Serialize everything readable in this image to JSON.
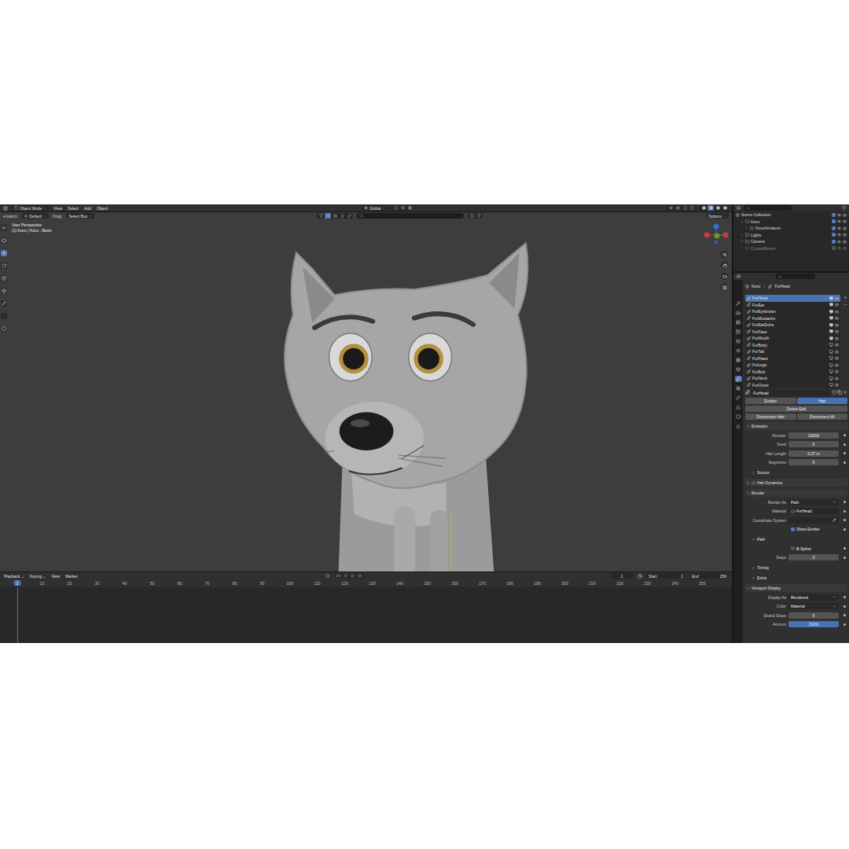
{
  "header": {
    "mode": "Object Mode",
    "menus": [
      "View",
      "Select",
      "Add",
      "Object"
    ],
    "transform_space": "Global",
    "shading": [
      {
        "selected": false
      },
      {
        "selected": true
      },
      {
        "selected": false
      },
      {
        "selected": false
      }
    ]
  },
  "tool_settings": {
    "orientation_label": "entation:",
    "orientation": "Default",
    "drag_label": "Drag:",
    "drag": "Select Box",
    "options": "Options"
  },
  "viewport": {
    "perspective": "User Perspective",
    "object_info": "(1) Kovu | Kovu : Basis"
  },
  "tools": [
    {
      "selected": false
    },
    {
      "selected": false
    },
    {
      "selected": true
    },
    {
      "selected": false
    },
    {
      "selected": false
    },
    {
      "selected": false
    },
    {
      "selected": false
    },
    {
      "selected": false
    },
    {
      "selected": false
    }
  ],
  "timeline": {
    "menus": [
      "Playback",
      "Keying",
      "View",
      "Marker"
    ],
    "current_frame": "1",
    "start_label": "Start",
    "start": "1",
    "end_label": "End",
    "end": "250",
    "ruler": [
      "1",
      "10",
      "20",
      "30",
      "40",
      "50",
      "60",
      "70",
      "80",
      "90",
      "100",
      "110",
      "120",
      "130",
      "140",
      "150",
      "160",
      "170",
      "180",
      "190",
      "200",
      "210",
      "220",
      "230",
      "240",
      "250"
    ]
  },
  "outliner": {
    "items": [
      {
        "label": "Scene Collection",
        "depth": 0,
        "expanded": true,
        "included": true
      },
      {
        "label": "Kovu",
        "depth": 1,
        "expanded": true,
        "included": true
      },
      {
        "label": "KovuArmature",
        "depth": 2,
        "expanded": false,
        "included": true
      },
      {
        "label": "Lights",
        "depth": 1,
        "expanded": false,
        "included": true
      },
      {
        "label": "Camera",
        "depth": 1,
        "expanded": false,
        "included": true
      },
      {
        "label": "CustomBones",
        "depth": 1,
        "expanded": false,
        "included": false
      }
    ]
  },
  "properties": {
    "tabs": [
      {
        "selected": false
      },
      {
        "selected": false
      },
      {
        "selected": false
      },
      {
        "selected": false
      },
      {
        "selected": false
      },
      {
        "selected": false
      },
      {
        "selected": false
      },
      {
        "selected": false
      },
      {
        "selected": true
      },
      {
        "selected": false
      },
      {
        "selected": false
      },
      {
        "selected": false
      },
      {
        "selected": false
      },
      {
        "selected": false
      }
    ],
    "breadcrumb": [
      "Kovu",
      "FurHead"
    ],
    "particle_systems": [
      {
        "label": "FurHead",
        "selected": true,
        "show_viewport": true
      },
      {
        "label": "FurEar",
        "selected": false,
        "show_viewport": true
      },
      {
        "label": "FurEyebrown",
        "selected": false,
        "show_viewport": true
      },
      {
        "label": "FurMustache",
        "selected": false,
        "show_viewport": true
      },
      {
        "label": "FurEarExtra",
        "selected": false,
        "show_viewport": true
      },
      {
        "label": "FurFace",
        "selected": false,
        "show_viewport": true
      },
      {
        "label": "FurMouth",
        "selected": false,
        "show_viewport": true
      },
      {
        "label": "FurBody",
        "selected": false,
        "show_viewport": false
      },
      {
        "label": "FurTail",
        "selected": false,
        "show_viewport": false
      },
      {
        "label": "FurPaws",
        "selected": false,
        "show_viewport": false
      },
      {
        "label": "FurLegs",
        "selected": false,
        "show_viewport": false
      },
      {
        "label": "FurButt",
        "selected": false,
        "show_viewport": false
      },
      {
        "label": "FurNeck",
        "selected": false,
        "show_viewport": false
      },
      {
        "label": "FurChest",
        "selected": false,
        "show_viewport": false
      }
    ],
    "system_name": "FurHead",
    "type_toggle": [
      {
        "label": "Emitter",
        "selected": false
      },
      {
        "label": "Hair",
        "selected": true
      }
    ],
    "actions": [
      [
        "Delete Edit"
      ],
      [
        "Disconnect Hair",
        "Disconnect All"
      ]
    ],
    "sections": [
      {
        "title": "Emission",
        "kind": "panel",
        "expanded": true,
        "rows": [
          {
            "kind": "number",
            "label": "Number",
            "value": "10000"
          },
          {
            "kind": "number",
            "label": "Seed",
            "value": "0"
          },
          {
            "kind": "number",
            "label": "Hair Length",
            "value": "0.07 m"
          },
          {
            "kind": "number",
            "label": "Segments",
            "value": "5"
          }
        ]
      },
      {
        "title": "Source",
        "kind": "subpanel",
        "expanded": false,
        "rows": []
      },
      {
        "title": "Hair Dynamics",
        "kind": "panel",
        "expanded": false,
        "checkbox": false,
        "rows": []
      },
      {
        "title": "Render",
        "kind": "panel",
        "expanded": true,
        "rows": [
          {
            "kind": "dropdown",
            "label": "Render As",
            "value": "Path"
          },
          {
            "kind": "datablock",
            "label": "Material",
            "value": "FurHead"
          },
          {
            "kind": "picker",
            "label": "Coordinate System"
          },
          {
            "kind": "checkbox",
            "label": "Show Emitter",
            "checked": true
          }
        ]
      },
      {
        "title": "Path",
        "kind": "subpanel",
        "expanded": true,
        "rows": [
          {
            "kind": "checkbox",
            "label": "B-Spline",
            "checked": false
          },
          {
            "kind": "number",
            "label": "Steps",
            "value": "3"
          }
        ]
      },
      {
        "title": "Timing",
        "kind": "subpanel",
        "expanded": false,
        "rows": []
      },
      {
        "title": "Extra",
        "kind": "subpanel",
        "expanded": false,
        "rows": []
      },
      {
        "title": "Viewport Display",
        "kind": "panel",
        "expanded": true,
        "rows": [
          {
            "kind": "dropdown",
            "label": "Display As",
            "value": "Rendered"
          },
          {
            "kind": "dropdown",
            "label": "Color",
            "value": "Material"
          },
          {
            "kind": "number",
            "label": "Strand Steps",
            "value": "5"
          },
          {
            "kind": "slider",
            "label": "Amount",
            "value": "100%",
            "level": 1
          }
        ]
      }
    ]
  }
}
